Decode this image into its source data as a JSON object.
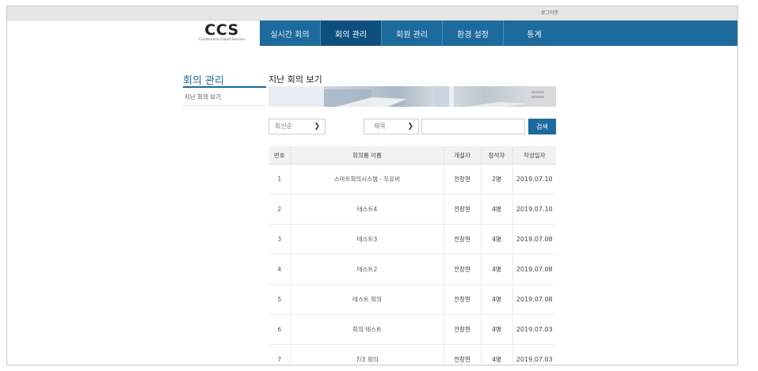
{
  "topbar": {
    "logout_label": "로그아웃"
  },
  "logo": {
    "main": "CCS",
    "sub": "Conference Cloud Service"
  },
  "nav": {
    "items": [
      {
        "label": "실시간 회의"
      },
      {
        "label": "회의 관리",
        "active": true
      },
      {
        "label": "회원 관리"
      },
      {
        "label": "환경 설정"
      },
      {
        "label": "통계"
      }
    ]
  },
  "sidebar": {
    "title": "회의 관리",
    "items": [
      {
        "label": "지난 회의 보기"
      }
    ]
  },
  "main": {
    "page_title": "지난 회의 보기",
    "sort_select": {
      "value": "최신순"
    },
    "field_select": {
      "value": "제목"
    },
    "search": {
      "value": "",
      "placeholder": ""
    },
    "search_button": "검색",
    "table": {
      "columns": [
        "번호",
        "회의룸 이름",
        "개설자",
        "참석자",
        "작성일자"
      ],
      "rows": [
        [
          "1",
          "스마트회의시스템 - 두유비",
          "전창현",
          "2명",
          "2019.07.10"
        ],
        [
          "2",
          "테스트4",
          "전창현",
          "4명",
          "2019.07.10"
        ],
        [
          "3",
          "테스트3",
          "전창현",
          "4명",
          "2019.07.08"
        ],
        [
          "4",
          "테스트2",
          "전창현",
          "4명",
          "2019.07.08"
        ],
        [
          "5",
          "테스트 회의",
          "전창현",
          "4명",
          "2019.07.08"
        ],
        [
          "6",
          "회의 테스트",
          "전창현",
          "4명",
          "2019.07.03"
        ],
        [
          "7",
          "7/3 회의",
          "전창현",
          "4명",
          "2019.07.03"
        ]
      ]
    }
  },
  "colors": {
    "primary": "#1d6a9c",
    "primary_dark": "#0f4f7e"
  }
}
